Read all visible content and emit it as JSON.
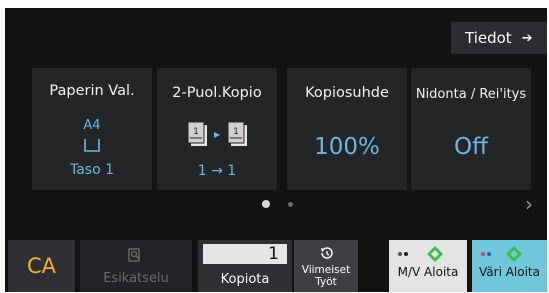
{
  "header": {
    "info_label": "Tiedot",
    "info_arrow": "➔"
  },
  "cards": {
    "paper": {
      "title": "Paperin Val.",
      "size": "A4",
      "tray": "Taso 1",
      "icon": "paper-tray-icon"
    },
    "duplex": {
      "title": "2-Puol.Kopio",
      "mode": "1 → 1",
      "icon": "duplex-copy-icon"
    },
    "ratio": {
      "title": "Kopiosuhde",
      "value": "100%"
    },
    "staple": {
      "title": "Nidonta / Rei'itys",
      "value": "Off"
    }
  },
  "pager": {
    "next_arrow": "›"
  },
  "bottom": {
    "ca_label": "CA",
    "preview_label": "Esikatselu",
    "copies_value": "1",
    "copies_label": "Kopiota",
    "jobs_label": "Viimeiset Työt",
    "bw_label": "M/V Aloita",
    "color_label": "Väri Aloita"
  },
  "colors": {
    "background": "#131314",
    "card": "#242527",
    "accent_blue": "#6cb7df",
    "ca_text": "#f0b42b",
    "color_start": "#6ec7dc",
    "start_green": "#3bbf4a"
  }
}
